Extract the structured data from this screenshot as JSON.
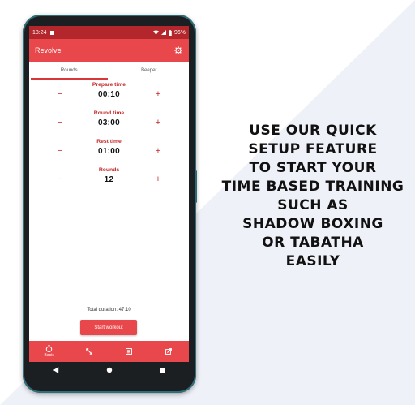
{
  "colors": {
    "status_bar": "#b3262b",
    "app_bar": "#e8484b",
    "accent_text": "#c62828",
    "background_diagonal": "#eef1f8"
  },
  "status_bar": {
    "time": "18:24",
    "battery": "96%"
  },
  "app_bar": {
    "title": "Revolve",
    "settings_icon": "gear-icon"
  },
  "tabs": [
    {
      "label": "Rounds",
      "active": true
    },
    {
      "label": "Beeper",
      "active": false
    }
  ],
  "settings": [
    {
      "label": "Prepare time",
      "value": "00:10",
      "minus": "−",
      "plus": "+"
    },
    {
      "label": "Round time",
      "value": "03:00",
      "minus": "−",
      "plus": "+"
    },
    {
      "label": "Rest time",
      "value": "01:00",
      "minus": "−",
      "plus": "+"
    },
    {
      "label": "Rounds",
      "value": "12",
      "minus": "−",
      "plus": "+"
    }
  ],
  "total_duration": "Total duration:  47:10",
  "start_button": "Start workout",
  "bottom_nav": [
    {
      "icon": "stopwatch-icon",
      "label": "Basic"
    },
    {
      "icon": "expand-icon",
      "label": ""
    },
    {
      "icon": "list-icon",
      "label": ""
    },
    {
      "icon": "export-icon",
      "label": ""
    }
  ],
  "promo_lines": [
    "USE OUR QUICK",
    "SETUP FEATURE",
    "TO START YOUR",
    "TIME BASED TRAINING",
    "SUCH AS",
    "SHADOW BOXING",
    "OR TABATHA",
    "EASILY"
  ]
}
